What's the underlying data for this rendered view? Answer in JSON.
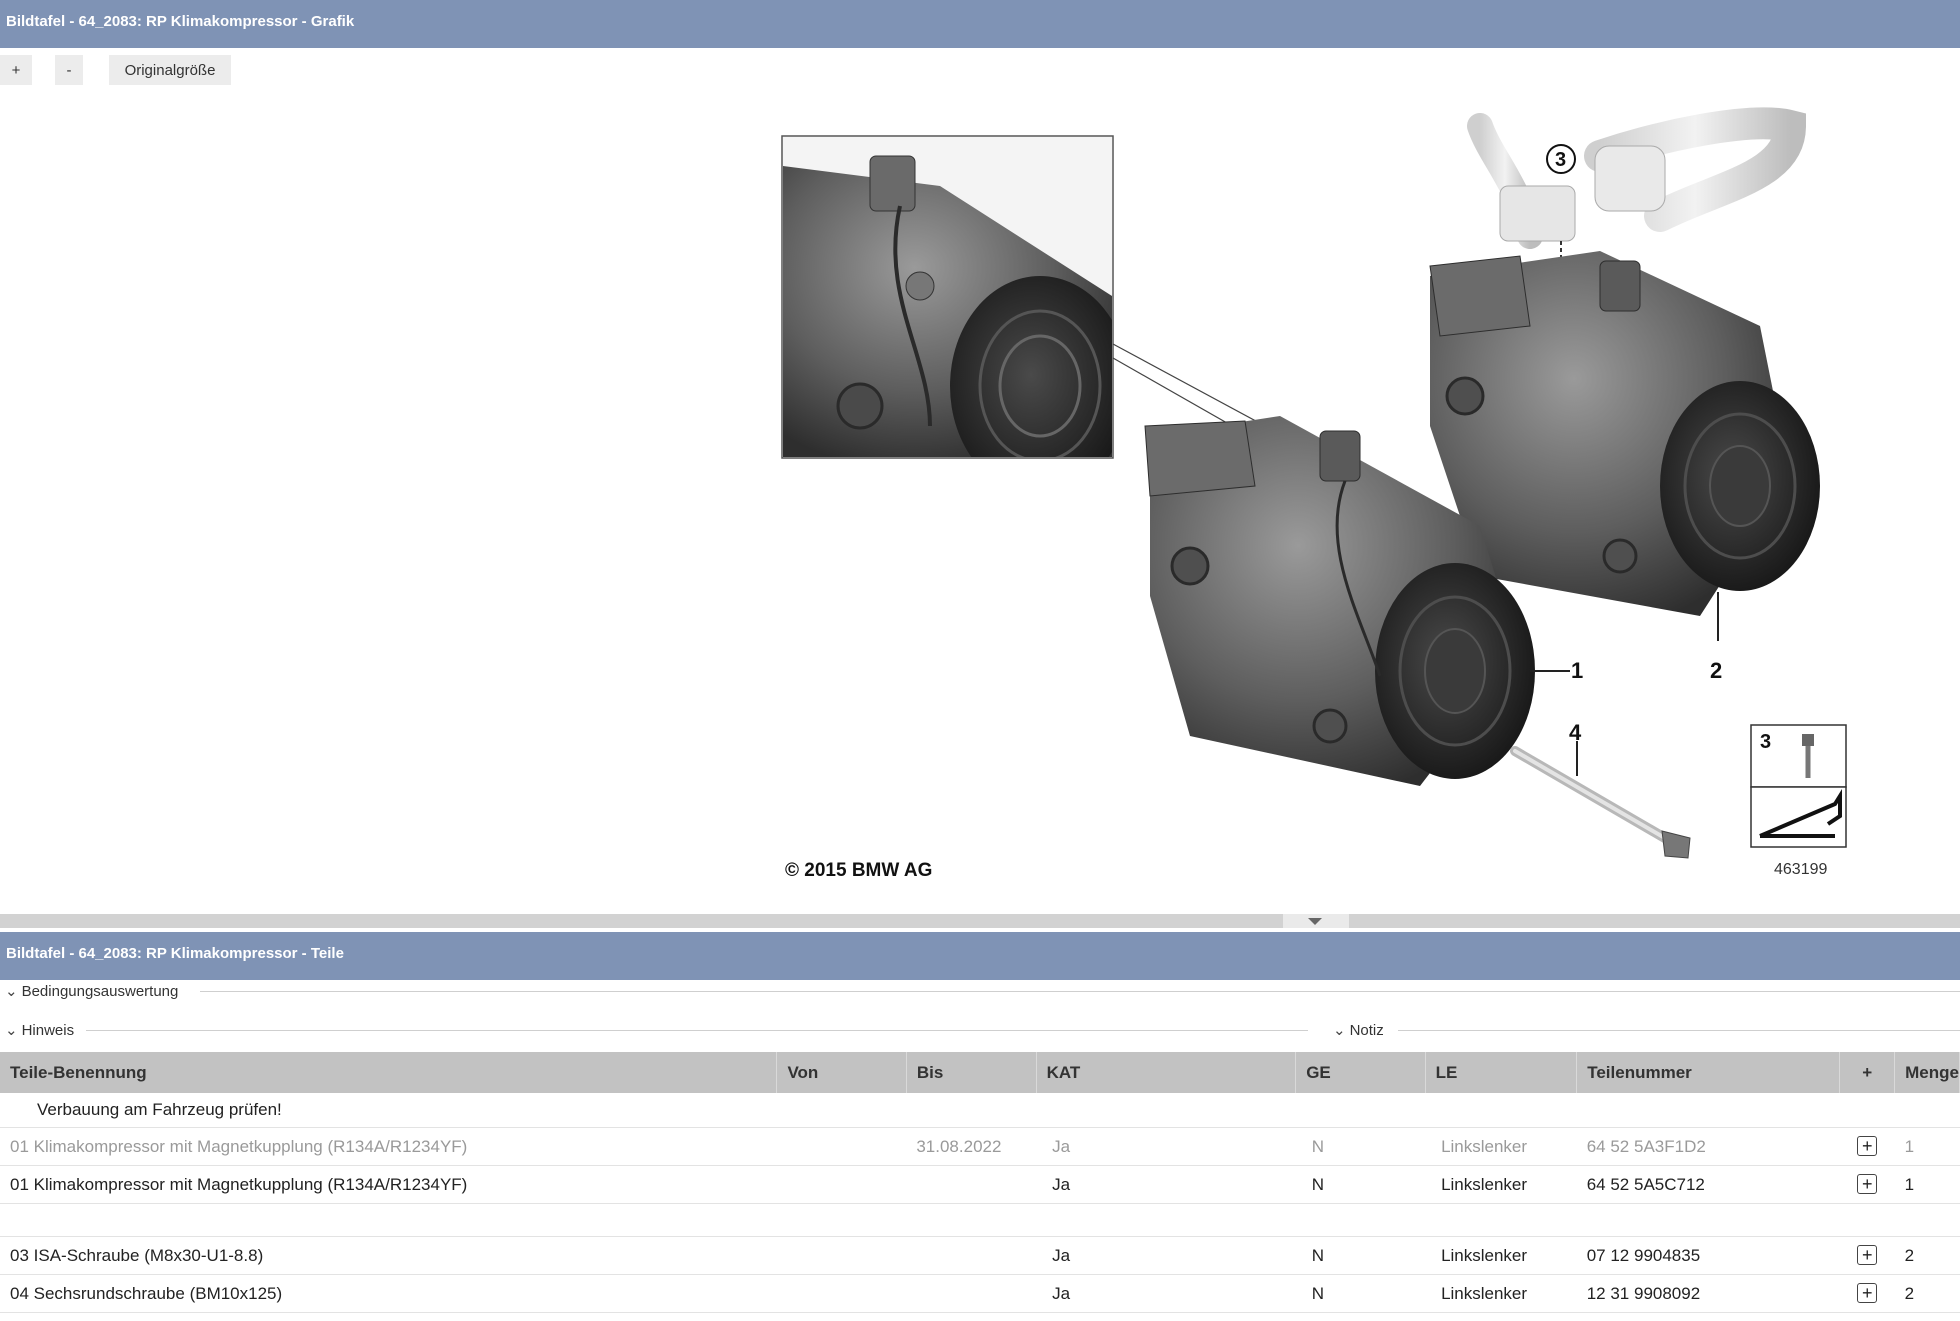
{
  "header": {
    "title": "Bildtafel - 64_2083: RP Klimakompressor - Grafik"
  },
  "toolbar": {
    "zoom_in": "+",
    "zoom_out": "-",
    "original_size": "Originalgröße"
  },
  "graphic": {
    "callouts": [
      "1",
      "2",
      "3",
      "4"
    ],
    "copyright": "© 2015 BMW AG",
    "legend_number": "3",
    "image_number": "463199"
  },
  "parts_panel": {
    "title": "Bildtafel - 64_2083: RP Klimakompressor - Teile",
    "sections": {
      "conditions": "Bedingungsauswertung",
      "hint": "Hinweis",
      "note": "Notiz"
    },
    "columns": [
      "Teile-Benennung",
      "Von",
      "Bis",
      "KAT",
      "GE",
      "LE",
      "Teilenummer",
      "+",
      "Menge"
    ],
    "note_row": "Verbauung am Fahrzeug prüfen!",
    "rows": [
      {
        "name": "01 Klimakompressor mit Magnetkupplung (R134A/R1234YF)",
        "von": "",
        "bis": "31.08.2022",
        "kat": "Ja",
        "ge": "N",
        "le": "Linkslenker",
        "number": "64 52 5A3F1D2",
        "add": "+",
        "qty": "1"
      },
      {
        "name": "01 Klimakompressor mit Magnetkupplung (R134A/R1234YF)",
        "von": "",
        "bis": "",
        "kat": "Ja",
        "ge": "N",
        "le": "Linkslenker",
        "number": "64 52 5A5C712",
        "add": "+",
        "qty": "1"
      },
      {
        "name": "03 ISA-Schraube (M8x30-U1-8.8)",
        "von": "",
        "bis": "",
        "kat": "Ja",
        "ge": "N",
        "le": "Linkslenker",
        "number": "07 12 9904835",
        "add": "+",
        "qty": "2"
      },
      {
        "name": "04 Sechsrundschraube (BM10x125)",
        "von": "",
        "bis": "",
        "kat": "Ja",
        "ge": "N",
        "le": "Linkslenker",
        "number": "12 31 9908092",
        "add": "+",
        "qty": "2"
      }
    ]
  }
}
